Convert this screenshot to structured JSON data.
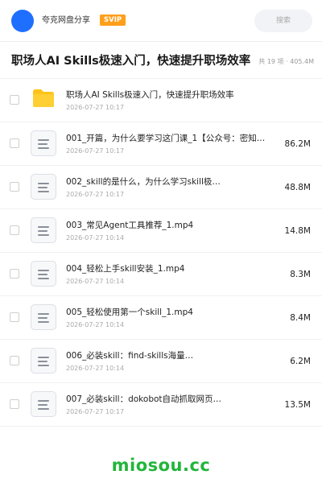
{
  "header": {
    "user_name": "夸克网盘分享",
    "badge": "SVIP",
    "search_placeholder": "搜索",
    "colors": {
      "avatar": "#1f6fff",
      "badge": "#ff9f1a"
    }
  },
  "folder": {
    "title": "职场人AI Skills极速入门，快速提升职场效率",
    "meta": "共 19 项 · 405.4M"
  },
  "files": [
    {
      "icon": "folder-icon",
      "name": "职场人AI Skills极速入门，快速提升职场效率",
      "date": "2026-07-27 10:17",
      "size": ""
    },
    {
      "icon": "document-icon",
      "name": "001_开篇，为什么要学习这门课_1【公众号：密知…",
      "date": "2026-07-27 10:17",
      "size": "86.2M"
    },
    {
      "icon": "document-icon",
      "name": "002_skill的是什么，为什么学习skill极…",
      "date": "2026-07-27 10:17",
      "size": "48.8M"
    },
    {
      "icon": "document-icon",
      "name": "003_常见Agent工具推荐_1.mp4",
      "date": "2026-07-27 10:14",
      "size": "14.8M"
    },
    {
      "icon": "document-icon",
      "name": "004_轻松上手skill安装_1.mp4",
      "date": "2026-07-27 10:14",
      "size": "8.3M"
    },
    {
      "icon": "document-icon",
      "name": "005_轻松使用第一个skill_1.mp4",
      "date": "2026-07-27 10:14",
      "size": "8.4M"
    },
    {
      "icon": "document-icon",
      "name": "006_必装skill：find-skills海量…",
      "date": "2026-07-27 10:14",
      "size": "6.2M"
    },
    {
      "icon": "document-icon",
      "name": "007_必装skill：dokobot自动抓取网页…",
      "date": "2026-07-27 10:17",
      "size": "13.5M"
    }
  ],
  "footer": {
    "brand": "miosou.cc",
    "color": "#22b53a"
  }
}
